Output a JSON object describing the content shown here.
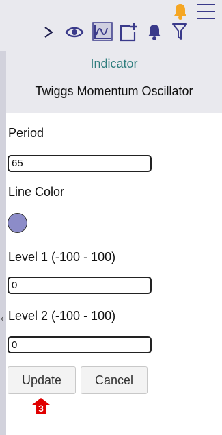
{
  "toolbar": {
    "icons": [
      "play-icon",
      "eye-icon",
      "chart-line-icon",
      "add-panel-icon",
      "bell-icon",
      "filter-icon",
      "notification-bell-icon",
      "menu-icon"
    ],
    "active_icon": "chart-line-icon",
    "accent_color": "#3a3a8a",
    "alert_color": "#f5a623"
  },
  "panel": {
    "title": "Indicator",
    "subtitle": "Twiggs Momentum Oscillator"
  },
  "form": {
    "period_label": "Period",
    "period_value": "65",
    "line_color_label": "Line Color",
    "line_color_value": "#8c8cc8",
    "level1_label": "Level 1 (-100 - 100)",
    "level1_value": "0",
    "level2_label": "Level 2 (-100 - 100)",
    "level2_value": "0"
  },
  "buttons": {
    "update_label": "Update",
    "cancel_label": "Cancel"
  },
  "annotation": {
    "badge_number": "3",
    "badge_color": "#e00000"
  },
  "sidebar": {
    "collapse_glyph": "‹"
  }
}
